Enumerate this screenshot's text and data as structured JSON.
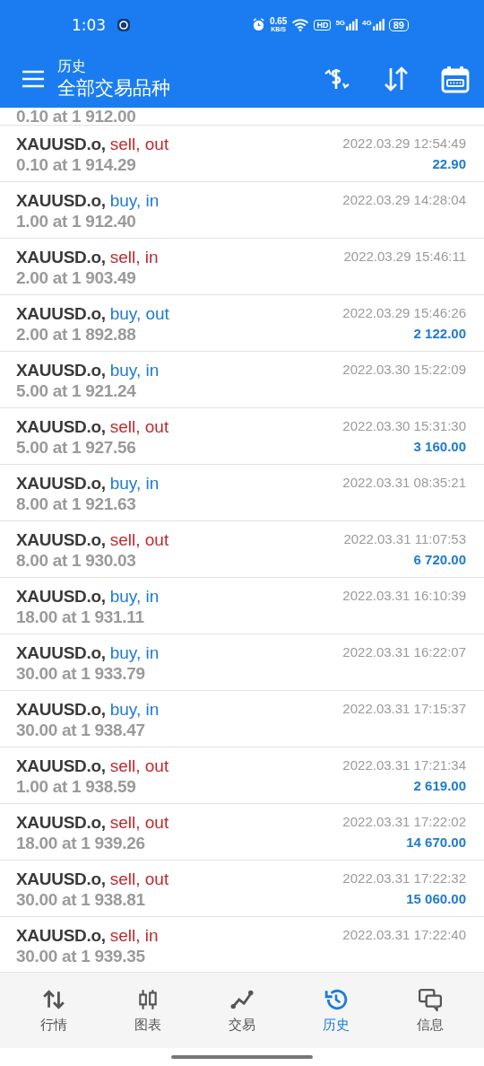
{
  "status_bar": {
    "time": "1:03",
    "speed": "0.65",
    "speed_unit": "KB/S",
    "hd": "HD",
    "net1": "5G",
    "net2": "4G",
    "battery": "89"
  },
  "header": {
    "title": "历史",
    "subtitle": "全部交易品种"
  },
  "partial_row": {
    "volume": "0.10 at 1 912.00"
  },
  "deals": [
    {
      "symbol": "XAUUSD.o,",
      "kind": "sell",
      "action": "sell, out",
      "volume": "0.10 at 1 914.29",
      "time": "2022.03.29 12:54:49",
      "profit": "22.90"
    },
    {
      "symbol": "XAUUSD.o,",
      "kind": "buy",
      "action": "buy, in",
      "volume": "1.00 at 1 912.40",
      "time": "2022.03.29 14:28:04"
    },
    {
      "symbol": "XAUUSD.o,",
      "kind": "sell",
      "action": "sell, in",
      "volume": "2.00 at 1 903.49",
      "time": "2022.03.29 15:46:11"
    },
    {
      "symbol": "XAUUSD.o,",
      "kind": "buy",
      "action": "buy, out",
      "volume": "2.00 at 1 892.88",
      "time": "2022.03.29 15:46:26",
      "profit": "2 122.00"
    },
    {
      "symbol": "XAUUSD.o,",
      "kind": "buy",
      "action": "buy, in",
      "volume": "5.00 at 1 921.24",
      "time": "2022.03.30 15:22:09"
    },
    {
      "symbol": "XAUUSD.o,",
      "kind": "sell",
      "action": "sell, out",
      "volume": "5.00 at 1 927.56",
      "time": "2022.03.30 15:31:30",
      "profit": "3 160.00"
    },
    {
      "symbol": "XAUUSD.o,",
      "kind": "buy",
      "action": "buy, in",
      "volume": "8.00 at 1 921.63",
      "time": "2022.03.31 08:35:21"
    },
    {
      "symbol": "XAUUSD.o,",
      "kind": "sell",
      "action": "sell, out",
      "volume": "8.00 at 1 930.03",
      "time": "2022.03.31 11:07:53",
      "profit": "6 720.00"
    },
    {
      "symbol": "XAUUSD.o,",
      "kind": "buy",
      "action": "buy, in",
      "volume": "18.00 at 1 931.11",
      "time": "2022.03.31 16:10:39"
    },
    {
      "symbol": "XAUUSD.o,",
      "kind": "buy",
      "action": "buy, in",
      "volume": "30.00 at 1 933.79",
      "time": "2022.03.31 16:22:07"
    },
    {
      "symbol": "XAUUSD.o,",
      "kind": "buy",
      "action": "buy, in",
      "volume": "30.00 at 1 938.47",
      "time": "2022.03.31 17:15:37"
    },
    {
      "symbol": "XAUUSD.o,",
      "kind": "sell",
      "action": "sell, out",
      "volume": "1.00 at 1 938.59",
      "time": "2022.03.31 17:21:34",
      "profit": "2 619.00"
    },
    {
      "symbol": "XAUUSD.o,",
      "kind": "sell",
      "action": "sell, out",
      "volume": "18.00 at 1 939.26",
      "time": "2022.03.31 17:22:02",
      "profit": "14 670.00"
    },
    {
      "symbol": "XAUUSD.o,",
      "kind": "sell",
      "action": "sell, out",
      "volume": "30.00 at 1 938.81",
      "time": "2022.03.31 17:22:32",
      "profit": "15 060.00"
    },
    {
      "symbol": "XAUUSD.o,",
      "kind": "sell",
      "action": "sell, in",
      "volume": "30.00 at 1 939.35",
      "time": "2022.03.31 17:22:40"
    }
  ],
  "nav": [
    {
      "kind": "quotes",
      "label": "行情",
      "selected": false
    },
    {
      "kind": "chart",
      "label": "图表",
      "selected": false
    },
    {
      "kind": "trade",
      "label": "交易",
      "selected": false
    },
    {
      "kind": "history",
      "label": "历史",
      "selected": true
    },
    {
      "kind": "messages",
      "label": "信息",
      "selected": false
    }
  ]
}
